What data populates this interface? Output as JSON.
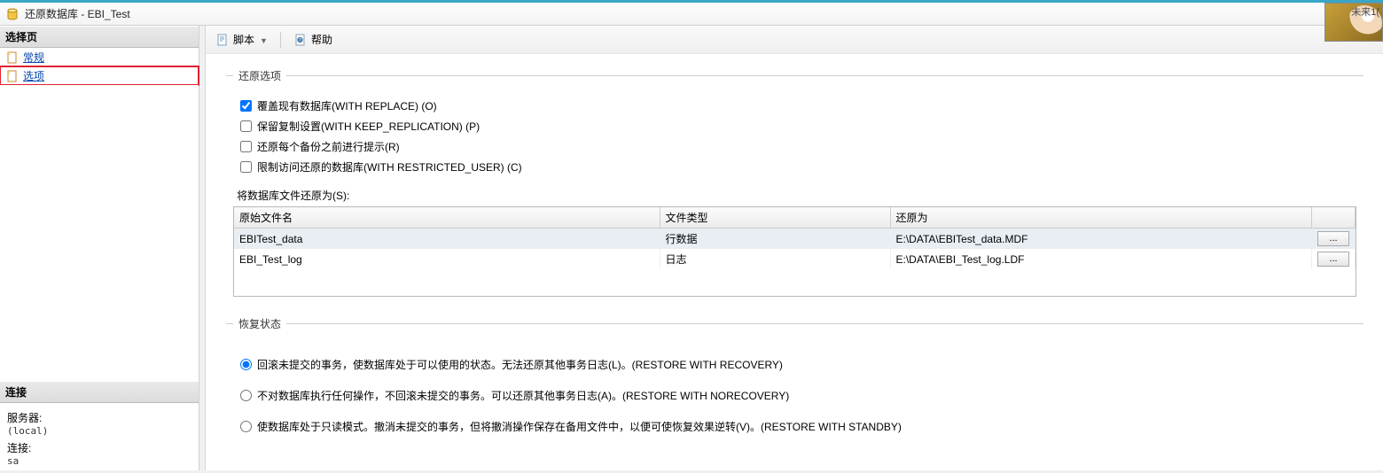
{
  "window": {
    "title": "还原数据库 - EBI_Test"
  },
  "float_label": "未来1(",
  "left": {
    "section_header": "选择页",
    "nav": [
      {
        "label": "常规",
        "link": true,
        "selected": false
      },
      {
        "label": "选项",
        "link": true,
        "selected": true
      }
    ],
    "conn_header": "连接",
    "server_label": "服务器:",
    "server_value": "(local)",
    "conn_label": "连接:",
    "conn_value": "sa"
  },
  "toolbar": {
    "script_label": "脚本",
    "help_label": "帮助"
  },
  "restore_options": {
    "legend": "还原选项",
    "chk_overwrite": "覆盖现有数据库(WITH REPLACE) (O)",
    "chk_keep_replication": "保留复制设置(WITH KEEP_REPLICATION) (P)",
    "chk_prompt_each": "还原每个备份之前进行提示(R)",
    "chk_restricted": "限制访问还原的数据库(WITH RESTRICTED_USER) (C)",
    "files_label": "将数据库文件还原为(S):",
    "table": {
      "col_orig": "原始文件名",
      "col_type": "文件类型",
      "col_restore_as": "还原为",
      "rows": [
        {
          "orig": "EBITest_data",
          "type": "行数据",
          "restore_as": "E:\\DATA\\EBITest_data.MDF"
        },
        {
          "orig": "EBI_Test_log",
          "type": "日志",
          "restore_as": "E:\\DATA\\EBI_Test_log.LDF"
        }
      ],
      "browse_label": "..."
    }
  },
  "recovery_state": {
    "legend": "恢复状态",
    "opt_recovery": "回滚未提交的事务，使数据库处于可以使用的状态。无法还原其他事务日志(L)。(RESTORE WITH RECOVERY)",
    "opt_norecovery": "不对数据库执行任何操作，不回滚未提交的事务。可以还原其他事务日志(A)。(RESTORE WITH NORECOVERY)",
    "opt_standby": "使数据库处于只读模式。撤消未提交的事务，但将撤消操作保存在备用文件中，以便可使恢复效果逆转(V)。(RESTORE WITH STANDBY)"
  }
}
